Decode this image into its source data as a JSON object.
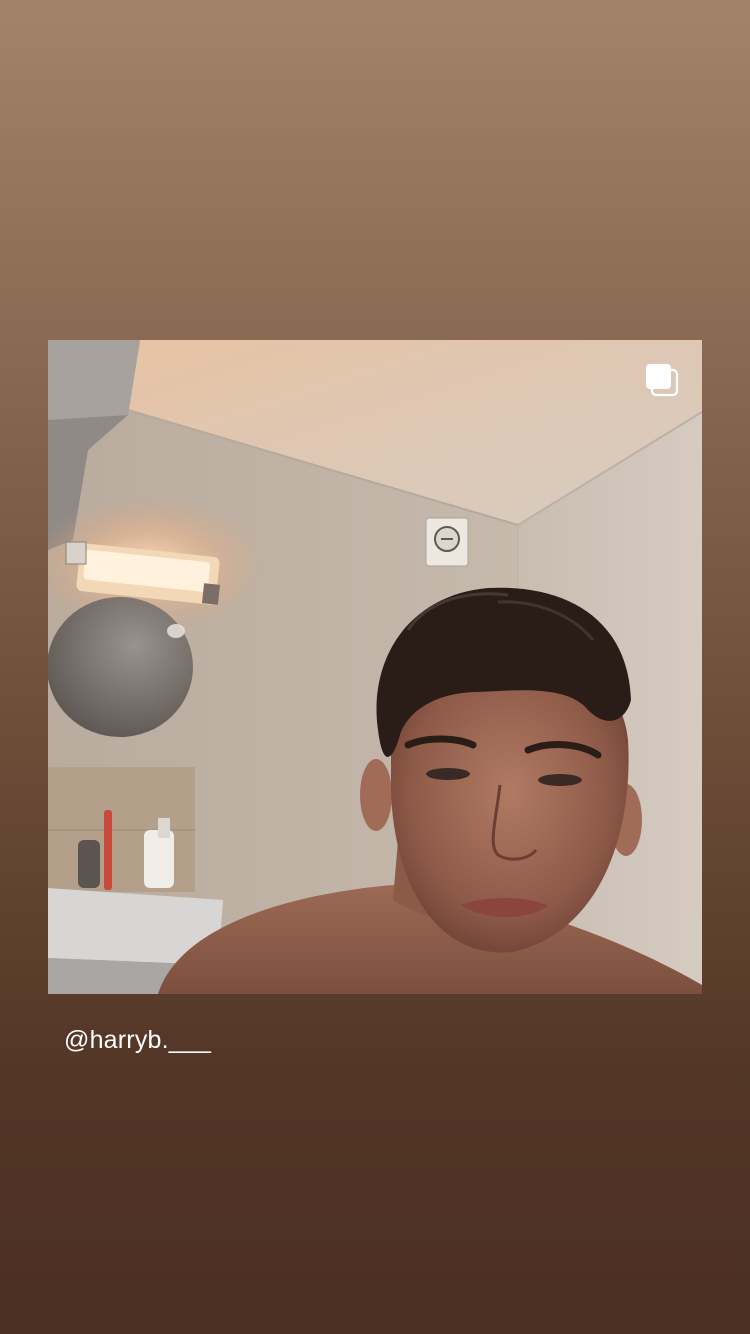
{
  "story": {
    "shared_post": {
      "username": "@harryb.___",
      "media_icon": "multiple-photos-icon",
      "photo_description_icon": "selfie-photo"
    }
  }
}
